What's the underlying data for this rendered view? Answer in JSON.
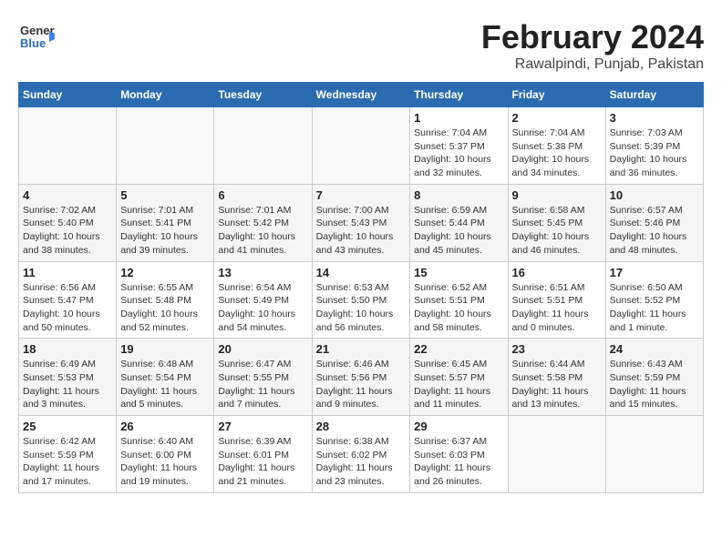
{
  "header": {
    "logo": {
      "line1": "General",
      "line2": "Blue"
    },
    "title": "February 2024",
    "location": "Rawalpindi, Punjab, Pakistan"
  },
  "weekdays": [
    "Sunday",
    "Monday",
    "Tuesday",
    "Wednesday",
    "Thursday",
    "Friday",
    "Saturday"
  ],
  "weeks": [
    [
      {
        "day": "",
        "sunrise": "",
        "sunset": "",
        "daylight": ""
      },
      {
        "day": "",
        "sunrise": "",
        "sunset": "",
        "daylight": ""
      },
      {
        "day": "",
        "sunrise": "",
        "sunset": "",
        "daylight": ""
      },
      {
        "day": "",
        "sunrise": "",
        "sunset": "",
        "daylight": ""
      },
      {
        "day": "1",
        "sunrise": "Sunrise: 7:04 AM",
        "sunset": "Sunset: 5:37 PM",
        "daylight": "Daylight: 10 hours and 32 minutes."
      },
      {
        "day": "2",
        "sunrise": "Sunrise: 7:04 AM",
        "sunset": "Sunset: 5:38 PM",
        "daylight": "Daylight: 10 hours and 34 minutes."
      },
      {
        "day": "3",
        "sunrise": "Sunrise: 7:03 AM",
        "sunset": "Sunset: 5:39 PM",
        "daylight": "Daylight: 10 hours and 36 minutes."
      }
    ],
    [
      {
        "day": "4",
        "sunrise": "Sunrise: 7:02 AM",
        "sunset": "Sunset: 5:40 PM",
        "daylight": "Daylight: 10 hours and 38 minutes."
      },
      {
        "day": "5",
        "sunrise": "Sunrise: 7:01 AM",
        "sunset": "Sunset: 5:41 PM",
        "daylight": "Daylight: 10 hours and 39 minutes."
      },
      {
        "day": "6",
        "sunrise": "Sunrise: 7:01 AM",
        "sunset": "Sunset: 5:42 PM",
        "daylight": "Daylight: 10 hours and 41 minutes."
      },
      {
        "day": "7",
        "sunrise": "Sunrise: 7:00 AM",
        "sunset": "Sunset: 5:43 PM",
        "daylight": "Daylight: 10 hours and 43 minutes."
      },
      {
        "day": "8",
        "sunrise": "Sunrise: 6:59 AM",
        "sunset": "Sunset: 5:44 PM",
        "daylight": "Daylight: 10 hours and 45 minutes."
      },
      {
        "day": "9",
        "sunrise": "Sunrise: 6:58 AM",
        "sunset": "Sunset: 5:45 PM",
        "daylight": "Daylight: 10 hours and 46 minutes."
      },
      {
        "day": "10",
        "sunrise": "Sunrise: 6:57 AM",
        "sunset": "Sunset: 5:46 PM",
        "daylight": "Daylight: 10 hours and 48 minutes."
      }
    ],
    [
      {
        "day": "11",
        "sunrise": "Sunrise: 6:56 AM",
        "sunset": "Sunset: 5:47 PM",
        "daylight": "Daylight: 10 hours and 50 minutes."
      },
      {
        "day": "12",
        "sunrise": "Sunrise: 6:55 AM",
        "sunset": "Sunset: 5:48 PM",
        "daylight": "Daylight: 10 hours and 52 minutes."
      },
      {
        "day": "13",
        "sunrise": "Sunrise: 6:54 AM",
        "sunset": "Sunset: 5:49 PM",
        "daylight": "Daylight: 10 hours and 54 minutes."
      },
      {
        "day": "14",
        "sunrise": "Sunrise: 6:53 AM",
        "sunset": "Sunset: 5:50 PM",
        "daylight": "Daylight: 10 hours and 56 minutes."
      },
      {
        "day": "15",
        "sunrise": "Sunrise: 6:52 AM",
        "sunset": "Sunset: 5:51 PM",
        "daylight": "Daylight: 10 hours and 58 minutes."
      },
      {
        "day": "16",
        "sunrise": "Sunrise: 6:51 AM",
        "sunset": "Sunset: 5:51 PM",
        "daylight": "Daylight: 11 hours and 0 minutes."
      },
      {
        "day": "17",
        "sunrise": "Sunrise: 6:50 AM",
        "sunset": "Sunset: 5:52 PM",
        "daylight": "Daylight: 11 hours and 1 minute."
      }
    ],
    [
      {
        "day": "18",
        "sunrise": "Sunrise: 6:49 AM",
        "sunset": "Sunset: 5:53 PM",
        "daylight": "Daylight: 11 hours and 3 minutes."
      },
      {
        "day": "19",
        "sunrise": "Sunrise: 6:48 AM",
        "sunset": "Sunset: 5:54 PM",
        "daylight": "Daylight: 11 hours and 5 minutes."
      },
      {
        "day": "20",
        "sunrise": "Sunrise: 6:47 AM",
        "sunset": "Sunset: 5:55 PM",
        "daylight": "Daylight: 11 hours and 7 minutes."
      },
      {
        "day": "21",
        "sunrise": "Sunrise: 6:46 AM",
        "sunset": "Sunset: 5:56 PM",
        "daylight": "Daylight: 11 hours and 9 minutes."
      },
      {
        "day": "22",
        "sunrise": "Sunrise: 6:45 AM",
        "sunset": "Sunset: 5:57 PM",
        "daylight": "Daylight: 11 hours and 11 minutes."
      },
      {
        "day": "23",
        "sunrise": "Sunrise: 6:44 AM",
        "sunset": "Sunset: 5:58 PM",
        "daylight": "Daylight: 11 hours and 13 minutes."
      },
      {
        "day": "24",
        "sunrise": "Sunrise: 6:43 AM",
        "sunset": "Sunset: 5:59 PM",
        "daylight": "Daylight: 11 hours and 15 minutes."
      }
    ],
    [
      {
        "day": "25",
        "sunrise": "Sunrise: 6:42 AM",
        "sunset": "Sunset: 5:59 PM",
        "daylight": "Daylight: 11 hours and 17 minutes."
      },
      {
        "day": "26",
        "sunrise": "Sunrise: 6:40 AM",
        "sunset": "Sunset: 6:00 PM",
        "daylight": "Daylight: 11 hours and 19 minutes."
      },
      {
        "day": "27",
        "sunrise": "Sunrise: 6:39 AM",
        "sunset": "Sunset: 6:01 PM",
        "daylight": "Daylight: 11 hours and 21 minutes."
      },
      {
        "day": "28",
        "sunrise": "Sunrise: 6:38 AM",
        "sunset": "Sunset: 6:02 PM",
        "daylight": "Daylight: 11 hours and 23 minutes."
      },
      {
        "day": "29",
        "sunrise": "Sunrise: 6:37 AM",
        "sunset": "Sunset: 6:03 PM",
        "daylight": "Daylight: 11 hours and 26 minutes."
      },
      {
        "day": "",
        "sunrise": "",
        "sunset": "",
        "daylight": ""
      },
      {
        "day": "",
        "sunrise": "",
        "sunset": "",
        "daylight": ""
      }
    ]
  ]
}
